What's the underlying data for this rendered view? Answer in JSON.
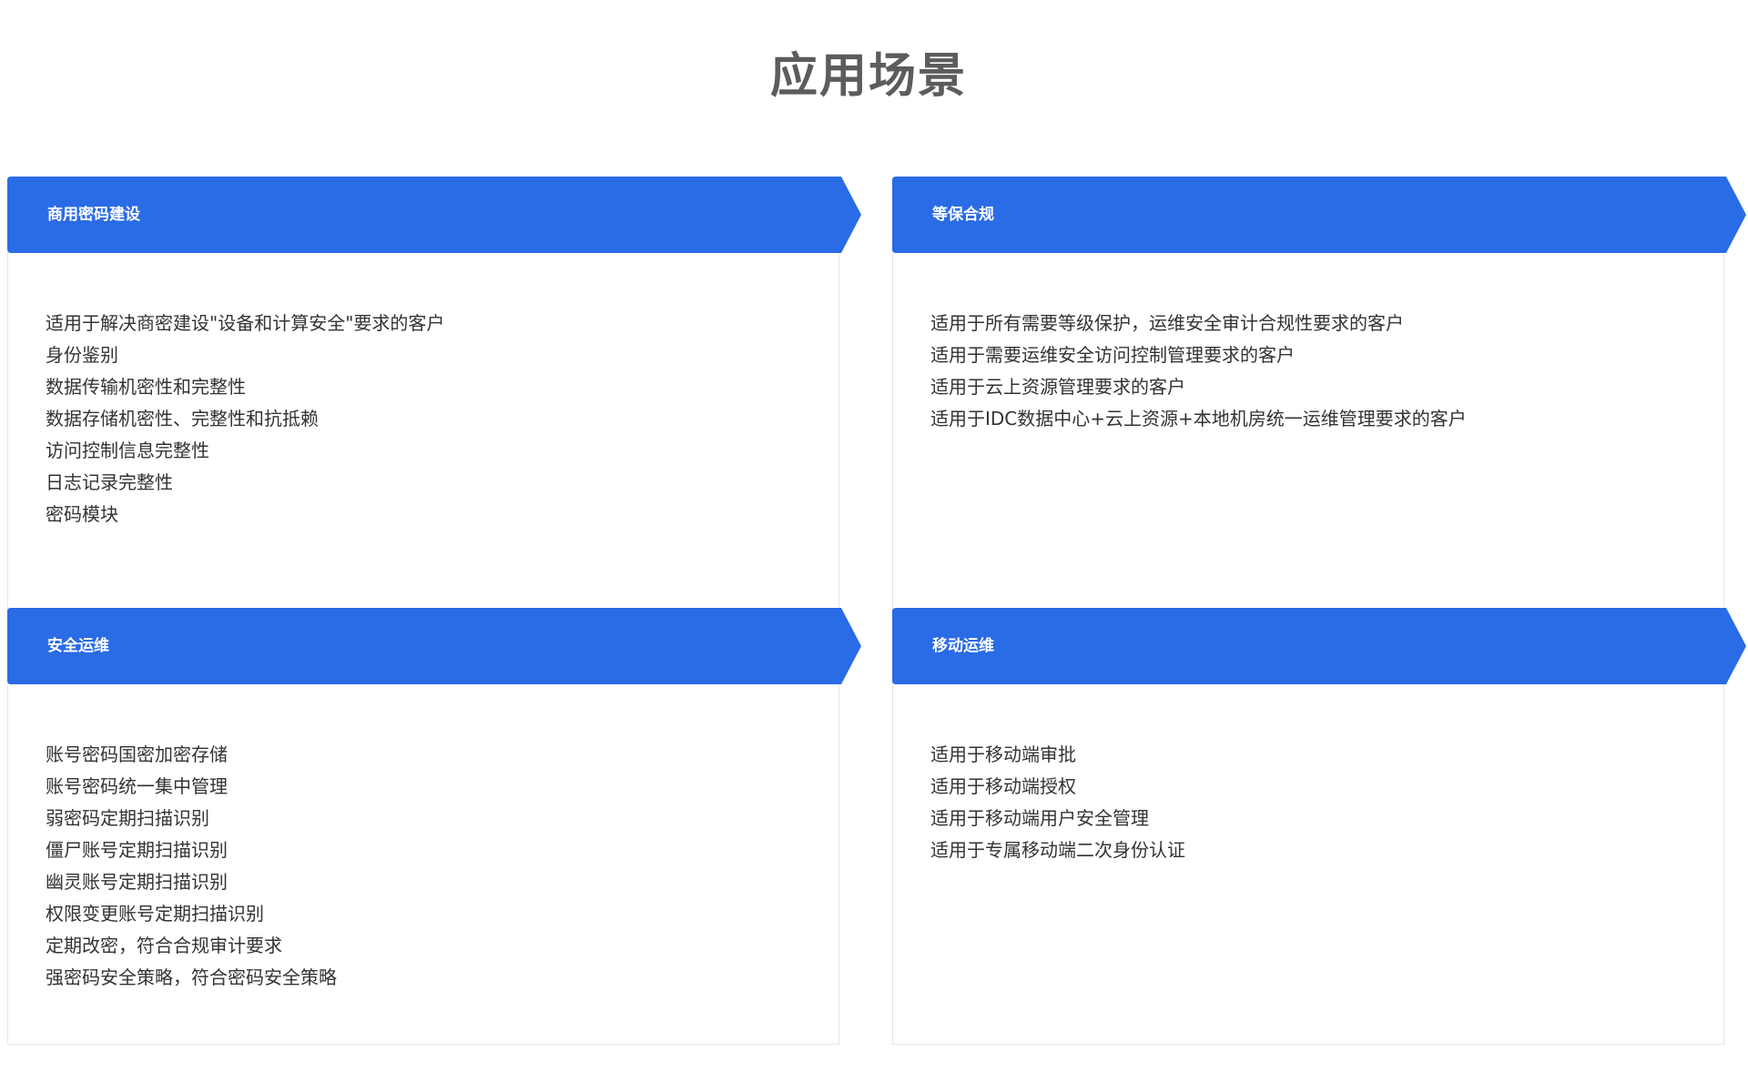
{
  "page": {
    "title": "应用场景"
  },
  "theme": {
    "accent": "#2a6be6"
  },
  "cards": [
    {
      "title": "商用密码建设",
      "items": [
        "适用于解决商密建设\"设备和计算安全\"要求的客户",
        "身份鉴别",
        "数据传输机密性和完整性",
        "数据存储机密性、完整性和抗抵赖",
        "访问控制信息完整性",
        "日志记录完整性",
        "密码模块"
      ]
    },
    {
      "title": "等保合规",
      "items": [
        "适用于所有需要等级保护，运维安全审计合规性要求的客户",
        "适用于需要运维安全访问控制管理要求的客户",
        "适用于云上资源管理要求的客户",
        "适用于IDC数据中心+云上资源+本地机房统一运维管理要求的客户"
      ]
    },
    {
      "title": "安全运维",
      "items": [
        "账号密码国密加密存储",
        "账号密码统一集中管理",
        "弱密码定期扫描识别",
        "僵尸账号定期扫描识别",
        "幽灵账号定期扫描识别",
        "权限变更账号定期扫描识别",
        "定期改密，符合合规审计要求",
        "强密码安全策略，符合密码安全策略"
      ]
    },
    {
      "title": "移动运维",
      "items": [
        "适用于移动端审批",
        "适用于移动端授权",
        "适用于移动端用户安全管理",
        "适用于专属移动端二次身份认证"
      ]
    }
  ]
}
